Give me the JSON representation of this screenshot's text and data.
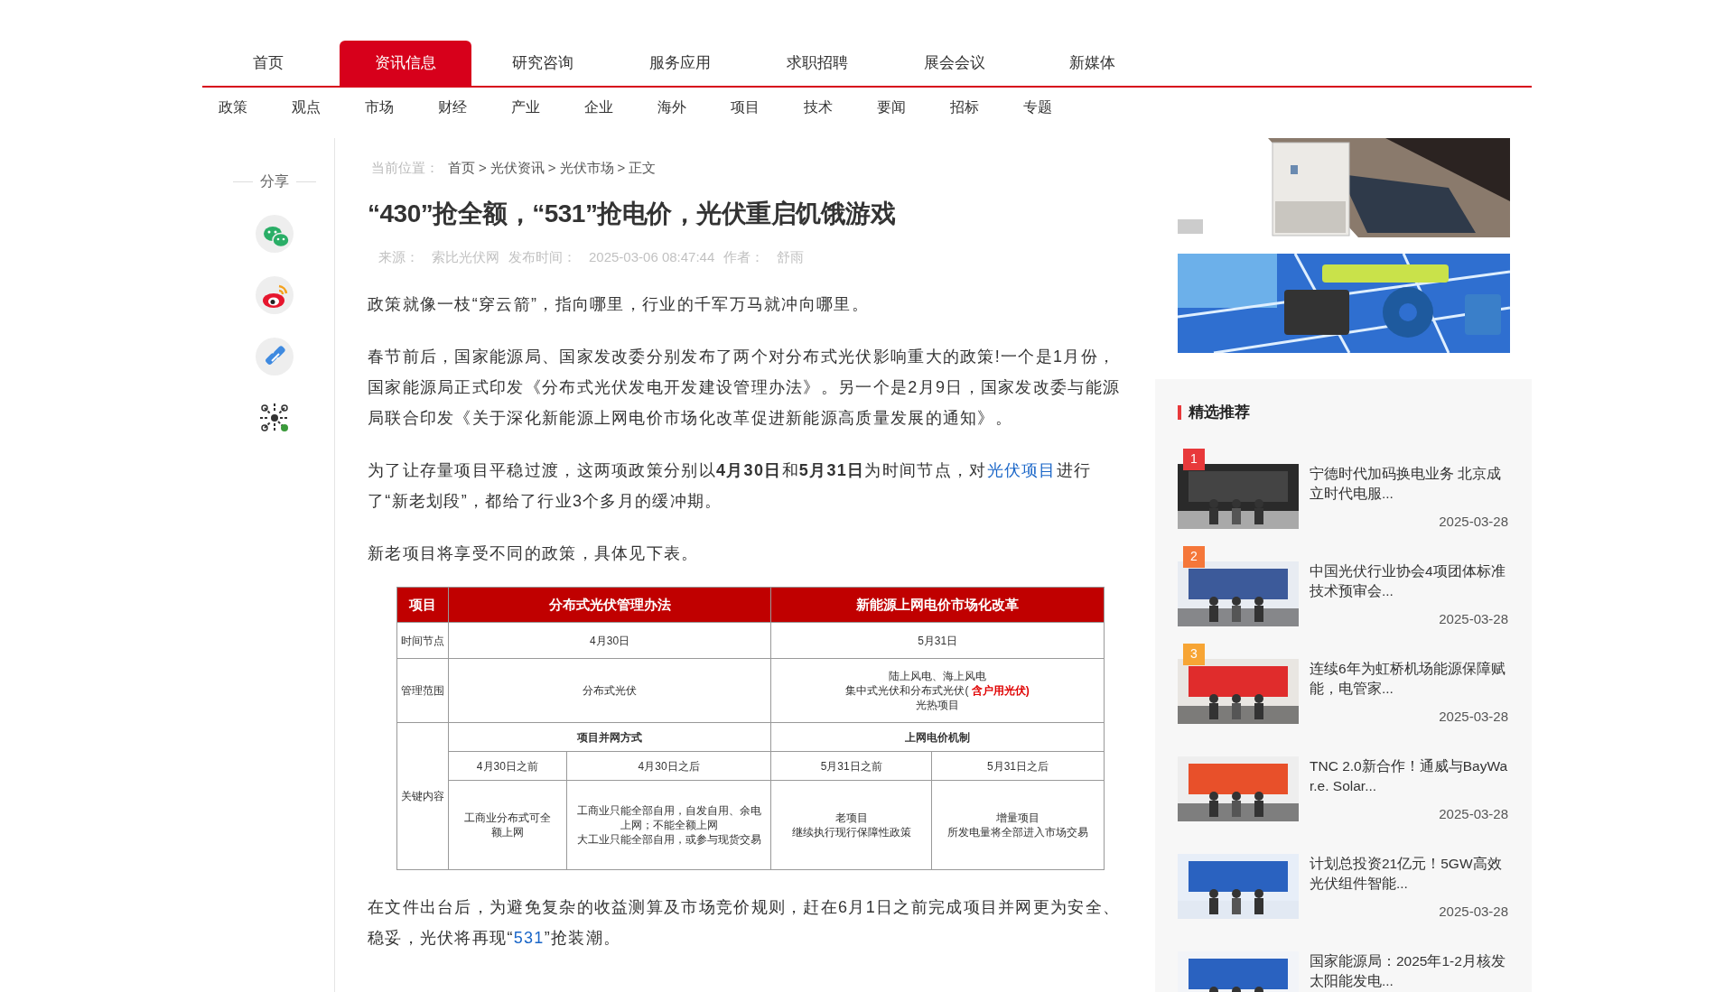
{
  "nav": {
    "tabs": [
      {
        "label": "首页",
        "selected": false
      },
      {
        "label": "资讯信息",
        "selected": true
      },
      {
        "label": "研究咨询",
        "selected": false
      },
      {
        "label": "服务应用",
        "selected": false
      },
      {
        "label": "求职招聘",
        "selected": false
      },
      {
        "label": "展会会议",
        "selected": false
      },
      {
        "label": "新媒体",
        "selected": false
      }
    ],
    "subnav": [
      "政策",
      "观点",
      "市场",
      "财经",
      "产业",
      "企业",
      "海外",
      "项目",
      "技术",
      "要闻",
      "招标",
      "专题"
    ]
  },
  "share": {
    "label": "分享",
    "icons": [
      {
        "kind": "wechat"
      },
      {
        "kind": "weibo"
      },
      {
        "kind": "link"
      },
      {
        "kind": "qrcode"
      }
    ]
  },
  "article": {
    "breadcrumb": {
      "label": "当前位置：",
      "path": [
        {
          "label": "首页"
        },
        {
          "separator": ">",
          "label": "光伏资讯"
        },
        {
          "separator": ">",
          "label": "光伏市场"
        },
        {
          "separator": ">",
          "label": "正文"
        }
      ]
    },
    "title": "“430”抢全额，“531”抢电价，光伏重启饥饿游戏",
    "meta": [
      {
        "label": "来源：",
        "value": "索比光伏网"
      },
      {
        "label": "发布时间：",
        "value": "2025-03-06 08:47:44"
      },
      {
        "label": "作者：",
        "value": "舒雨"
      }
    ],
    "paragraphs": [
      {
        "segments": [
          {
            "kind": "text",
            "text": "政策就像一枝“穿云箭”，指向哪里，行业的千军万马就冲向哪里。"
          }
        ]
      },
      {
        "segments": [
          {
            "kind": "text",
            "text": "春节前后，国家能源局、国家发改委分别发布了两个对分布式光伏影响重大的政策!一个是1月份，国家能源局正式印发《分布式光伏发电开发建设管理办法》。另一个是2月9日，国家发改委与能源局联合印发《关于深化新能源上网电价市场化改革促进新能源高质量发展的通知》。"
          }
        ]
      },
      {
        "segments": [
          {
            "kind": "text",
            "text": "为了让存量项目平稳过渡，这两项政策分别以**4月30日**和**5月31日**为时间节点，对"
          },
          {
            "kind": "link",
            "text": "光伏项目"
          },
          {
            "kind": "text",
            "text": "进行了“新老划段”，都给了行业3个多月的缓冲期。"
          }
        ]
      },
      {
        "segments": [
          {
            "kind": "text",
            "text": "新老项目将享受不同的政策，具体见下表。"
          }
        ]
      },
      {
        "kind": "table"
      },
      {
        "segments": [
          {
            "kind": "text",
            "text": "在文件出台后，为避免复杂的收益测算及市场竞价规则，赶在6月1日之前完成项目并网更为安全、稳妥，光伏将再现“"
          },
          {
            "kind": "link",
            "text": "531"
          },
          {
            "kind": "text",
            "text": "”抢装潮。"
          }
        ]
      }
    ],
    "table": {
      "columns": [
        {
          "text": "项目"
        },
        {
          "text": "分布式光伏管理办法",
          "colspan": 2
        },
        {
          "text": "新能源上网电价市场化改革",
          "colspan": 2
        }
      ],
      "rows": [
        {
          "cells": [
            {
              "lines": [
                {
                  "text": "时间节点"
                }
              ]
            },
            {
              "colspan": 2,
              "lines": [
                {
                  "text": "4月30日"
                }
              ]
            },
            {
              "colspan": 2,
              "lines": [
                {
                  "text": "5月31日"
                }
              ]
            }
          ]
        },
        {
          "cells": [
            {
              "lines": [
                {
                  "text": "管理范围"
                }
              ]
            },
            {
              "colspan": 2,
              "lines": [
                {
                  "text": "分布式光伏"
                }
              ]
            },
            {
              "colspan": 2,
              "lines": [
                {
                  "text": "陆上风电、海上风电"
                },
                {
                  "text": "集中式光伏和分布式光伏(",
                  "highlight": " 含户用光伏)"
                },
                {
                  "text": "光热项目"
                }
              ]
            }
          ]
        },
        {
          "cells": [
            {
              "rowspan": 3,
              "lines": [
                {
                  "text": "关键内容"
                }
              ]
            },
            {
              "colspan": 2,
              "bold": true,
              "lines": [
                {
                  "text": "项目并网方式"
                }
              ]
            },
            {
              "colspan": 2,
              "bold": true,
              "lines": [
                {
                  "text": "上网电价机制"
                }
              ]
            }
          ]
        },
        {
          "cells": [
            {
              "lines": [
                {
                  "text": "4月30日之前"
                }
              ]
            },
            {
              "lines": [
                {
                  "text": "4月30日之后"
                }
              ]
            },
            {
              "lines": [
                {
                  "text": "5月31日之前"
                }
              ]
            },
            {
              "lines": [
                {
                  "text": "5月31日之后"
                }
              ]
            }
          ]
        },
        {
          "cells": [
            {
              "lines": [
                {
                  "text": "工商业分布式可全"
                },
                {
                  "text": "额上网"
                }
              ]
            },
            {
              "lines": [
                {
                  "text": "工商业只能全部自用，自发自用、余电"
                },
                {
                  "text": "上网；不能全额上网"
                },
                {
                  "text": "大工业只能全部自用，或参与现货交易"
                }
              ]
            },
            {
              "lines": [
                {
                  "text": "老项目"
                },
                {
                  "text": "继续执行现行保障性政策"
                }
              ]
            },
            {
              "lines": [
                {
                  "text": "增量项目"
                },
                {
                  "text": "所发电量将全部进入市场交易"
                }
              ]
            }
          ]
        }
      ]
    }
  },
  "sidebar": {
    "recommend": {
      "title": "精选推荐",
      "items": [
        {
          "rank": "1",
          "color": "#e8393b",
          "title": "宁德时代加码换电业务 北京成立时代电服...",
          "date": "2025-03-28"
        },
        {
          "rank": "2",
          "color": "#f5773a",
          "title": "中国光伏行业协会4项团体标准技术预审会...",
          "date": "2025-03-28"
        },
        {
          "rank": "3",
          "color": "#f7a535",
          "title": "连续6年为虹桥机场能源保障赋能，电管家...",
          "date": "2025-03-28"
        },
        {
          "title": "TNC 2.0新合作！通威与BayWa r.e. Solar...",
          "date": "2025-03-28"
        },
        {
          "title": "计划总投资21亿元！5GW高效光伏组件智能...",
          "date": "2025-03-28"
        },
        {
          "title": "国家能源局：2025年1-2月核发太阳能发电..."
        }
      ]
    }
  }
}
